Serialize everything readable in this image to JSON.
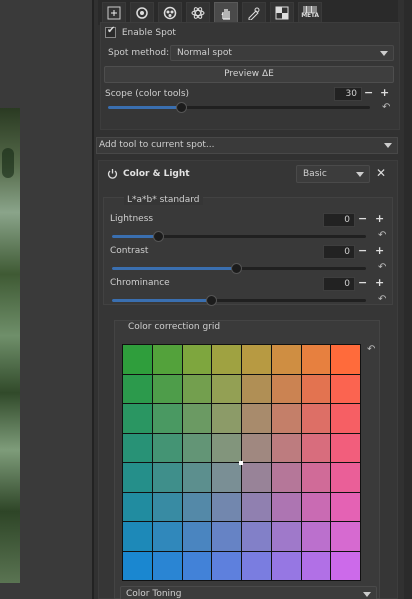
{
  "toolbar": {
    "icons": [
      "add-spot-icon",
      "circle-tool-icon",
      "color-wheel-icon",
      "atom-icon",
      "hand-icon",
      "edit-lens-icon",
      "checker-icon",
      "meta-icon"
    ],
    "meta_label": "META"
  },
  "spot": {
    "enable_label": "Enable Spot",
    "enable_checked": true,
    "method_label": "Spot method:",
    "method_value": "Normal spot",
    "preview_label": "Preview ΔE",
    "scope_label": "Scope (color tools)",
    "scope_value": "30",
    "scope_fraction": 0.28
  },
  "add_tool": {
    "label": "Add tool to current spot..."
  },
  "color_light": {
    "title": "Color & Light",
    "mode_value": "Basic",
    "lab_label": "L*a*b* standard",
    "sliders": [
      {
        "label": "Lightness",
        "value": "0",
        "fraction": 0.18
      },
      {
        "label": "Contrast",
        "value": "0",
        "fraction": 0.49
      },
      {
        "label": "Chrominance",
        "value": "0",
        "fraction": 0.39
      }
    ],
    "grid_title": "Color correction grid",
    "grid_colors": [
      [
        "#2f9e3c",
        "#53a23b",
        "#7ea63e",
        "#9fa241",
        "#b79a42",
        "#cf8e42",
        "#e7803f",
        "#ff6b3b"
      ],
      [
        "#2c9a4c",
        "#4e9d4a",
        "#739f4e",
        "#93a054",
        "#b08f55",
        "#cb8352",
        "#e37350",
        "#fb6450"
      ],
      [
        "#2a9662",
        "#4a9962",
        "#6b9a63",
        "#8c9b68",
        "#a88b6c",
        "#c47f69",
        "#dd6f66",
        "#f65f64"
      ],
      [
        "#289276",
        "#449474",
        "#639576",
        "#82957c",
        "#a08880",
        "#bd7c7f",
        "#d86d7d",
        "#f25e7c"
      ],
      [
        "#258f8a",
        "#3f8f8b",
        "#5c8f8e",
        "#7a8f95",
        "#988398",
        "#b57799",
        "#d06b98",
        "#ea5f98"
      ],
      [
        "#218ca0",
        "#388ba3",
        "#5489a8",
        "#7287ae",
        "#9080b0",
        "#ad75b2",
        "#c96bb3",
        "#e462b4"
      ],
      [
        "#1d89b8",
        "#3088bb",
        "#4a85c0",
        "#6683c5",
        "#8280c8",
        "#9f79ca",
        "#bb70cd",
        "#d66ad0"
      ],
      [
        "#1a87d0",
        "#2a85d3",
        "#4282d8",
        "#5e80dd",
        "#7a7de0",
        "#9677e3",
        "#b170e6",
        "#cc6aea"
      ]
    ],
    "toning_value": "Color Toning"
  }
}
